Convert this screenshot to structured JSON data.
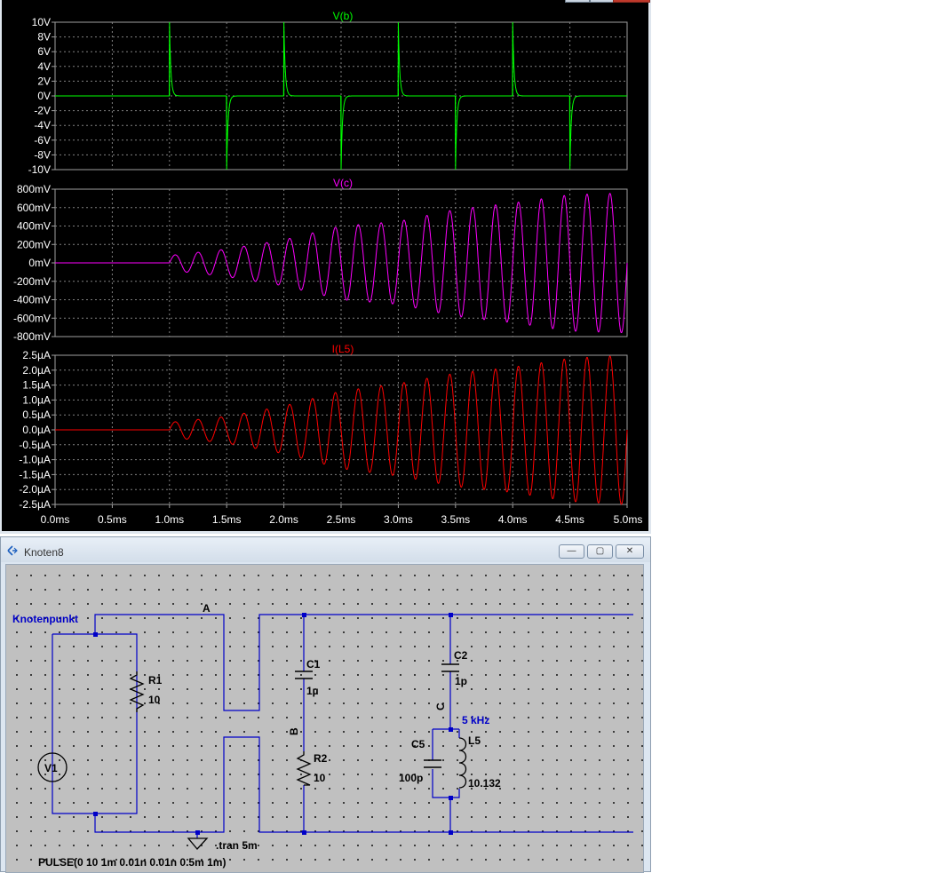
{
  "plot": {
    "panes": [
      {
        "trace_label": "V(b)",
        "trace_color": "#00ff00",
        "y_ticks": [
          "10V",
          "8V",
          "6V",
          "4V",
          "2V",
          "0V",
          "-2V",
          "-4V",
          "-6V",
          "-8V",
          "-10V"
        ],
        "ylim": [
          -10,
          10
        ],
        "unit": "V"
      },
      {
        "trace_label": "V(c)",
        "trace_color": "#ff00ff",
        "y_ticks": [
          "800mV",
          "600mV",
          "400mV",
          "200mV",
          "0mV",
          "-200mV",
          "-400mV",
          "-600mV",
          "-800mV"
        ],
        "ylim": [
          -800,
          800
        ],
        "unit": "mV"
      },
      {
        "trace_label": "I(L5)",
        "trace_color": "#ff0000",
        "y_ticks": [
          "2.5µA",
          "2.0µA",
          "1.5µA",
          "1.0µA",
          "0.5µA",
          "0.0µA",
          "-0.5µA",
          "-1.0µA",
          "-1.5µA",
          "-2.0µA",
          "-2.5µA"
        ],
        "ylim": [
          -2.5,
          2.5
        ],
        "unit": "µA"
      }
    ],
    "x_ticks": [
      "0.0ms",
      "0.5ms",
      "1.0ms",
      "1.5ms",
      "2.0ms",
      "2.5ms",
      "3.0ms",
      "3.5ms",
      "4.0ms",
      "4.5ms",
      "5.0ms"
    ],
    "xlim_ms": [
      0,
      5
    ],
    "grid_color": "#808080",
    "axis_text_color": "#ffffff"
  },
  "chart_data": [
    {
      "type": "line",
      "x_unit": "ms",
      "xlim": [
        0,
        5
      ],
      "ylim": [
        -10,
        10
      ],
      "series": [
        {
          "name": "V(b)",
          "color": "#00ff00",
          "events": [
            {
              "t": 1.0,
              "peak": 10
            },
            {
              "t": 1.5,
              "peak": -10
            },
            {
              "t": 2.0,
              "peak": 10
            },
            {
              "t": 2.5,
              "peak": -10
            },
            {
              "t": 3.0,
              "peak": 10
            },
            {
              "t": 3.5,
              "peak": -10
            },
            {
              "t": 4.0,
              "peak": 10
            },
            {
              "t": 4.5,
              "peak": -10
            }
          ],
          "baseline": 0
        }
      ]
    },
    {
      "type": "line",
      "x_unit": "ms",
      "xlim": [
        0,
        5
      ],
      "ylim": [
        -800,
        800
      ],
      "series": [
        {
          "name": "V(c)",
          "color": "#ff00ff",
          "start": 1.0,
          "frequency_khz": 5,
          "envelope": [
            [
              1.0,
              80
            ],
            [
              1.5,
              150
            ],
            [
              2.0,
              250
            ],
            [
              2.5,
              400
            ],
            [
              3.0,
              450
            ],
            [
              3.5,
              580
            ],
            [
              4.0,
              650
            ],
            [
              4.5,
              740
            ],
            [
              5.0,
              760
            ]
          ]
        }
      ]
    },
    {
      "type": "line",
      "x_unit": "ms",
      "xlim": [
        0,
        5
      ],
      "ylim": [
        -2.5,
        2.5
      ],
      "series": [
        {
          "name": "I(L5)",
          "color": "#ff0000",
          "start": 1.0,
          "frequency_khz": 5,
          "envelope": [
            [
              1.0,
              0.25
            ],
            [
              1.5,
              0.45
            ],
            [
              2.0,
              0.8
            ],
            [
              2.5,
              1.3
            ],
            [
              3.0,
              1.55
            ],
            [
              3.5,
              1.9
            ],
            [
              4.0,
              2.1
            ],
            [
              4.5,
              2.4
            ],
            [
              5.0,
              2.5
            ]
          ]
        }
      ]
    }
  ],
  "schematic": {
    "window_title": "Knoten8",
    "node_label": "Knotenpunkt",
    "net_labels": {
      "a": "A",
      "b": "B",
      "c": "C"
    },
    "components": {
      "r1": {
        "name": "R1",
        "value": "10"
      },
      "r2": {
        "name": "R2",
        "value": "10"
      },
      "c1": {
        "name": "C1",
        "value": "1µ"
      },
      "c2": {
        "name": "C2",
        "value": "1p"
      },
      "c5": {
        "name": "C5",
        "value": "100p"
      },
      "l5": {
        "name": "L5",
        "value": "10.132"
      },
      "v1": {
        "name": "V1"
      }
    },
    "resonance_label": "5 kHz",
    "tran_directive": ".tran 5m",
    "pulse_spec": "PULSE(0 10 1m 0.01n 0.01n 0.5m 1m)",
    "wire_color": "#0000c8",
    "text_color": "#000000",
    "blue_text_color": "#0000c8"
  },
  "window_buttons": {
    "minimize": "—",
    "maximize": "▢",
    "close": "✕"
  }
}
